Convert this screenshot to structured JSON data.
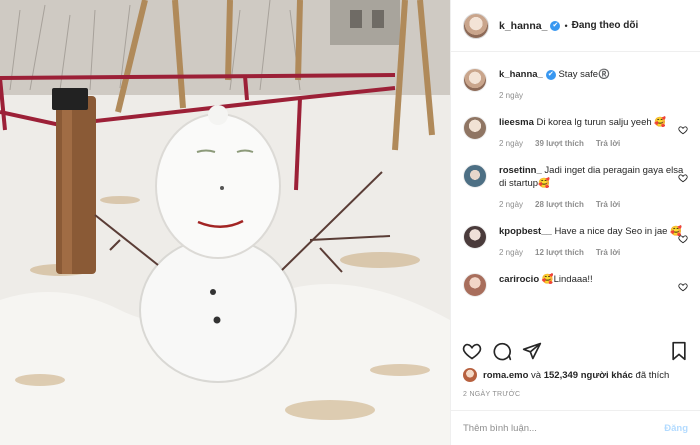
{
  "post": {
    "author": "k_hanna_",
    "verified_mark": "✔",
    "separator": "•",
    "follow_status": "Đang theo dõi",
    "caption_user": "k_hanna_",
    "caption_text": "Stay safe®️",
    "caption_time": "2 ngày"
  },
  "comments": [
    {
      "user": "lieesma",
      "text": "Di korea lg turun salju yeeh 🥰",
      "time": "2 ngày",
      "likes": "39 lượt thích",
      "reply": "Trả lời",
      "avatar_color": "#b9a89a"
    },
    {
      "user": "rosetinn_",
      "text": "Jadi inget dia peragain gaya elsa di startup🥰",
      "time": "2 ngày",
      "likes": "28 lượt thích",
      "reply": "Trả lời",
      "avatar_color": "#5f7f92"
    },
    {
      "user": "kpopbest__",
      "text": "Have a nice day Seo in jae 🥰",
      "time": "2 ngày",
      "likes": "12 lượt thích",
      "reply": "Trả lời",
      "avatar_color": "#7a6a6a"
    },
    {
      "user": "carirocio",
      "text": "🥰Lindaaa!!",
      "time": "",
      "likes": "",
      "reply": "",
      "avatar_color": "#c89a8a"
    }
  ],
  "likes": {
    "first_user": "roma.emo",
    "and_text": "và",
    "count": "152,349",
    "others_text": "người khác",
    "suffix": "đã thích"
  },
  "timestamp": "2 NGÀY TRƯỚC",
  "add_comment": {
    "placeholder": "Thêm bình luận...",
    "post_label": "Đăng"
  },
  "icons": {
    "like": "heart-icon",
    "comment": "comment-icon",
    "share": "share-icon",
    "save": "bookmark-icon"
  }
}
